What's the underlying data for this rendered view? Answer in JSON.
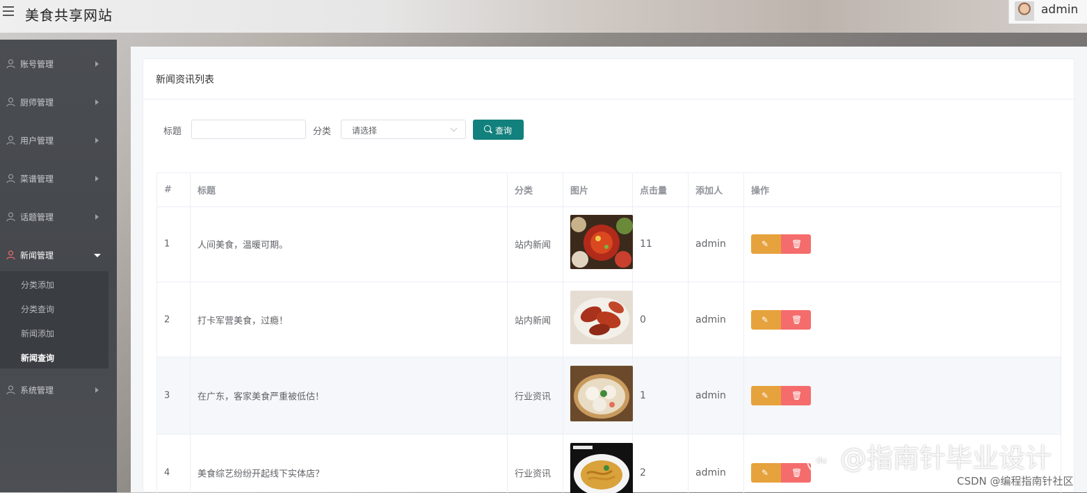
{
  "header": {
    "title": "美食共享网站",
    "username": "admin"
  },
  "sidebar": {
    "items": [
      {
        "label": "账号管理",
        "expanded": false
      },
      {
        "label": "厨师管理",
        "expanded": false
      },
      {
        "label": "用户管理",
        "expanded": false
      },
      {
        "label": "菜谱管理",
        "expanded": false
      },
      {
        "label": "话题管理",
        "expanded": false
      },
      {
        "label": "新闻管理",
        "expanded": true
      },
      {
        "label": "系统管理",
        "expanded": false
      }
    ],
    "submenu": [
      {
        "label": "分类添加",
        "active": false
      },
      {
        "label": "分类查询",
        "active": false
      },
      {
        "label": "新闻添加",
        "active": false
      },
      {
        "label": "新闻查询",
        "active": true
      }
    ]
  },
  "card": {
    "title": "新闻资讯列表"
  },
  "search": {
    "title_label": "标题",
    "title_value": "",
    "category_label": "分类",
    "category_placeholder": "请选择",
    "search_button": "查询"
  },
  "table": {
    "columns": [
      "#",
      "标题",
      "分类",
      "图片",
      "点击量",
      "添加人",
      "操作"
    ],
    "rows": [
      {
        "index": "1",
        "title": "人间美食，温暖可期。",
        "category": "站内新闻",
        "image": "hotpot-spread",
        "clicks": "11",
        "author": "admin"
      },
      {
        "index": "2",
        "title": "打卡军营美食，过瘾！",
        "category": "站内新闻",
        "image": "braised-crayfish",
        "clicks": "0",
        "author": "admin"
      },
      {
        "index": "3",
        "title": "在广东，客家美食严重被低估！",
        "category": "行业资讯",
        "image": "steamed-dumplings",
        "clicks": "1",
        "author": "admin"
      },
      {
        "index": "4",
        "title": "美食综艺纷纷开起线下实体店？",
        "category": "行业资讯",
        "image": "noodle-plate",
        "clicks": "2",
        "author": "admin"
      }
    ]
  },
  "watermark": {
    "main": "@指南针毕业设计",
    "sub": "CSDN @编程指南针社区"
  },
  "colors": {
    "primary": "#12807c",
    "edit": "#e6a23c",
    "delete": "#f56c6c",
    "sidebar": "#45484d"
  }
}
